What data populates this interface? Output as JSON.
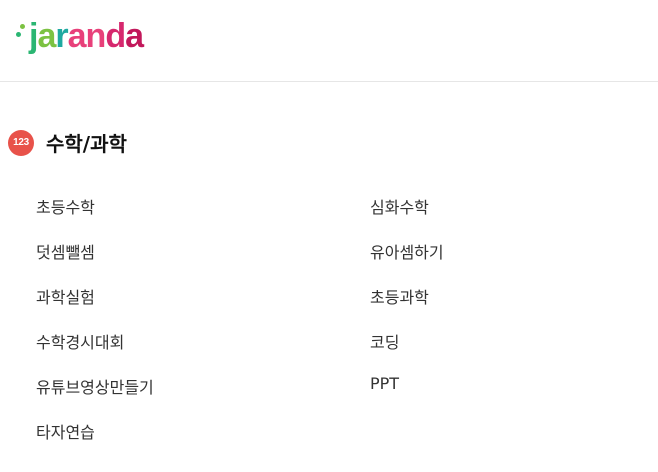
{
  "brand": {
    "name": "jaranda",
    "letters": [
      "j",
      "a",
      "r",
      "a",
      "n",
      "d",
      "a"
    ],
    "colors": [
      "#2bb673",
      "#7cc242",
      "#1ea9a0",
      "#e8407a",
      "#d6286e",
      "#c2185b"
    ]
  },
  "section": {
    "icon_text": "123",
    "icon_color": "#e8524a",
    "title": "수학/과학"
  },
  "categories": [
    "초등수학",
    "심화수학",
    "덧셈뺄셈",
    "유아셈하기",
    "과학실험",
    "초등과학",
    "수학경시대회",
    "코딩",
    "유튜브영상만들기",
    "PPT",
    "타자연습"
  ]
}
